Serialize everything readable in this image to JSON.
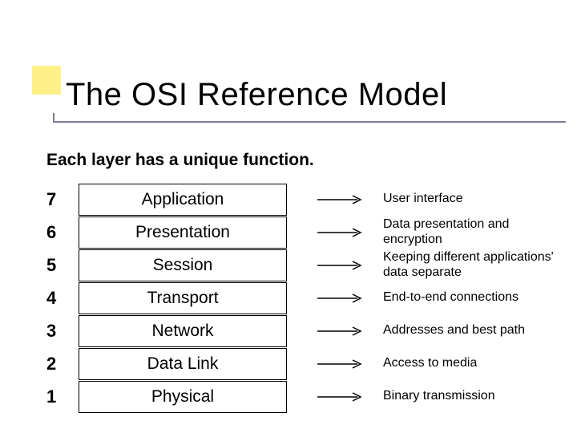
{
  "title": "The OSI Reference Model",
  "subtitle": "Each layer has a unique function.",
  "layers": [
    {
      "num": "7",
      "name": "Application",
      "desc": "User interface"
    },
    {
      "num": "6",
      "name": "Presentation",
      "desc": "Data presentation and encryption"
    },
    {
      "num": "5",
      "name": "Session",
      "desc": "Keeping different applications' data separate"
    },
    {
      "num": "4",
      "name": "Transport",
      "desc": "End-to-end connections"
    },
    {
      "num": "3",
      "name": "Network",
      "desc": "Addresses and best path"
    },
    {
      "num": "2",
      "name": "Data Link",
      "desc": "Access to media"
    },
    {
      "num": "1",
      "name": "Physical",
      "desc": "Binary transmission"
    }
  ],
  "colors": {
    "accent_yellow": "#fff088",
    "rule": "#7b7b96"
  }
}
